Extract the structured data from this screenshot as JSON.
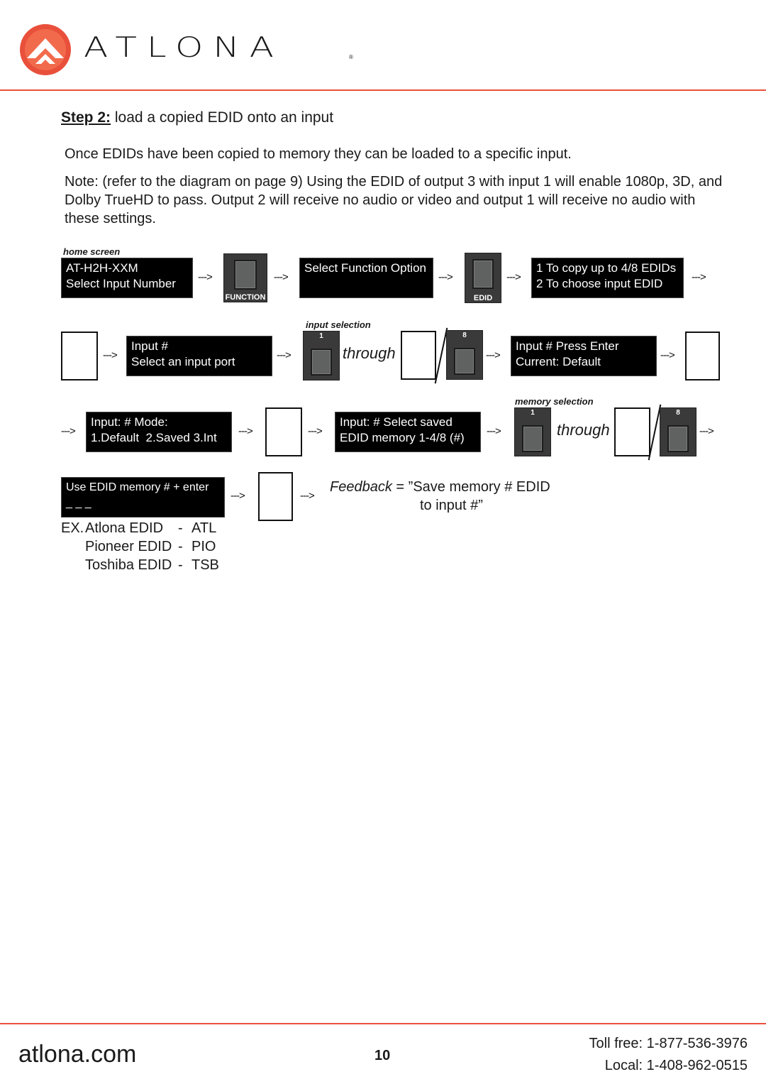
{
  "header": {
    "brand": "ATLONA",
    "registered_mark": "®",
    "accent_color": "#e9503b"
  },
  "step": {
    "label": "Step 2:",
    "title": "load a copied EDID onto an input"
  },
  "paragraphs": [
    "Once EDIDs have been copied to memory they can be loaded to a specific input.",
    "Note: (refer to the diagram on page 9) Using the EDID of output 3 with input 1 will enable 1080p, 3D, and Dolby TrueHD to pass. Output 2 will receive no audio or video and output 1 will receive no audio with these settings."
  ],
  "diagram": {
    "arrow": "--->",
    "through": "through",
    "captions": {
      "home_screen": "home screen",
      "input_selection": "input selection",
      "memory_selection": "memory selection"
    },
    "lcd": {
      "home": [
        "AT-H2H-XXM",
        "Select Input Number"
      ],
      "function": [
        "Select Function Option",
        ""
      ],
      "copy_choose": [
        "1 To copy up to 4/8 EDIDs",
        "2 To choose input EDID"
      ],
      "input_port": [
        "Input #",
        "Select an input port"
      ],
      "press_enter": [
        "Input # Press Enter",
        "Current: Default"
      ],
      "mode": [
        "Input: # Mode:",
        "1.Default  2.Saved 3.Int"
      ],
      "select_saved": [
        "Input: # Select saved",
        "EDID memory 1-4/8 (#)"
      ],
      "use_edid": [
        "Use EDID memory # + enter",
        "_ _ _"
      ]
    },
    "buttons": {
      "function": "FUNCTION",
      "edid": "EDID",
      "first": "1",
      "last": "8"
    },
    "feedback": {
      "label": "Feedback",
      "equals": "=",
      "line1": "”Save memory # EDID",
      "line2": "to input #”"
    },
    "examples": [
      {
        "prefix": "EX.",
        "name": "Atlona EDID",
        "code": "ATL"
      },
      {
        "prefix": "",
        "name": "Pioneer EDID",
        "code": "PIO"
      },
      {
        "prefix": "",
        "name": "Toshiba EDID",
        "code": "TSB"
      }
    ]
  },
  "footer": {
    "site": "atlona.com",
    "page_number": "10",
    "toll_free": "Toll free: 1-877-536-3976",
    "local": "Local: 1-408-962-0515"
  }
}
